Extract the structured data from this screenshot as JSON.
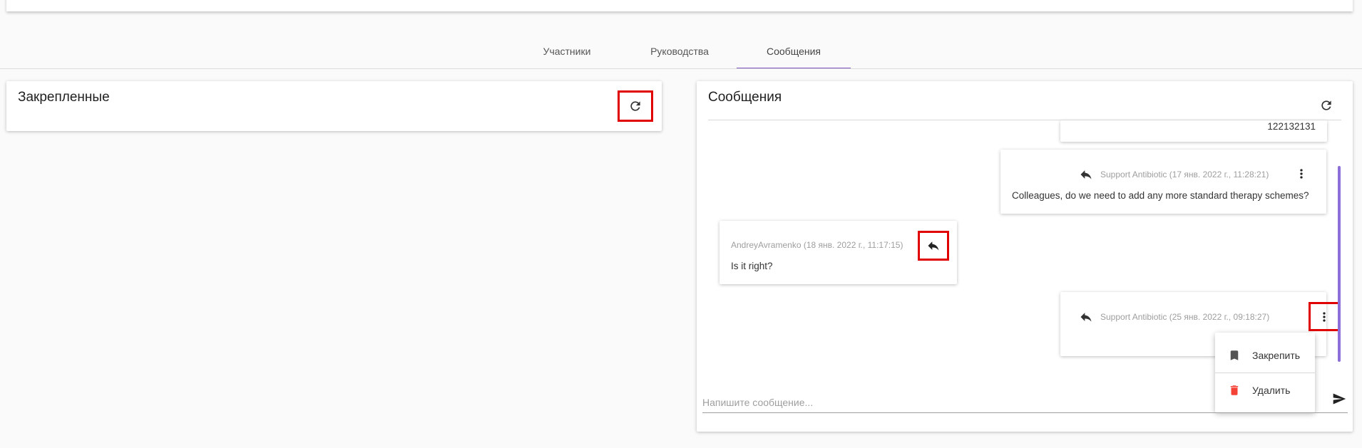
{
  "tabs": [
    {
      "label": "Участники"
    },
    {
      "label": "Руководства"
    },
    {
      "label": "Сообщения"
    }
  ],
  "pinned": {
    "title": "Закрепленные"
  },
  "messages_panel": {
    "title": "Сообщения",
    "messages": [
      {
        "text": "122132131"
      },
      {
        "meta": "Support Antibiotic (17 янв. 2022 г., 11:28:21)",
        "text": "Colleagues, do we need to add any more standard therapy schemes?"
      },
      {
        "meta": "AndreyAvramenko (18 янв. 2022 г., 11:17:15)",
        "text": "Is it right?"
      },
      {
        "meta": "Support Antibiotic (25 янв. 2022 г., 09:18:27)",
        "text": ""
      }
    ],
    "context_menu": [
      {
        "label": "Закрепить",
        "icon": "bookmark-icon"
      },
      {
        "label": "Удалить",
        "icon": "trash-icon"
      }
    ],
    "input": {
      "placeholder": "Напишите сообщение..."
    }
  },
  "colors": {
    "accent": "#7e57c2",
    "highlight": "#e00000",
    "delete": "#f44336"
  }
}
